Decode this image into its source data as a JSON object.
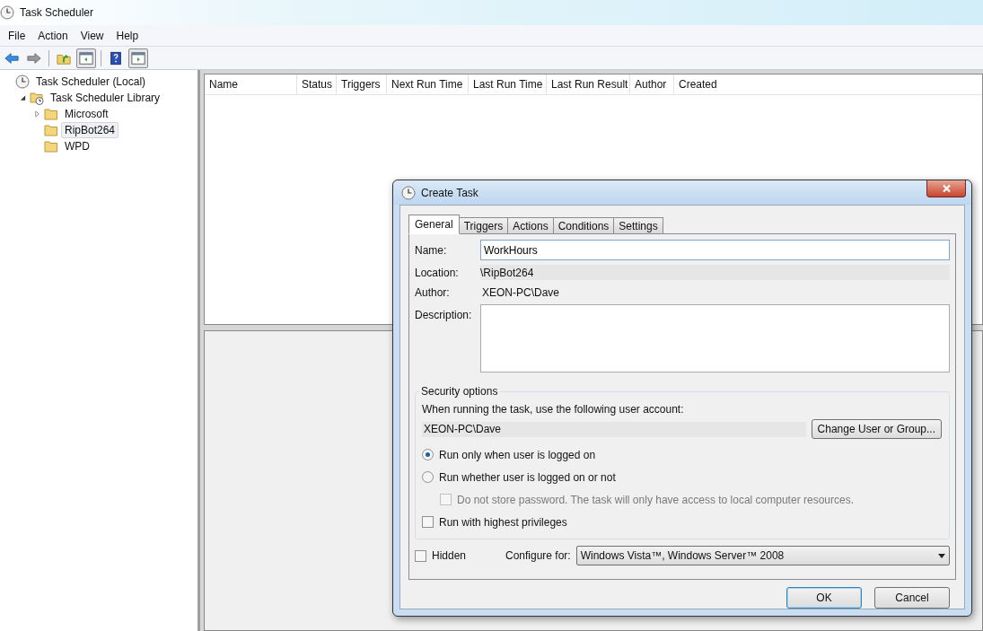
{
  "window": {
    "title": "Task Scheduler"
  },
  "menu": [
    "File",
    "Action",
    "View",
    "Help"
  ],
  "toolbar": [
    {
      "pressed": false
    },
    {
      "pressed": false
    },
    {
      "pressed": false
    },
    {
      "pressed": true
    },
    {
      "pressed": false
    },
    {
      "pressed": true
    }
  ],
  "tree": [
    {
      "label": "Task Scheduler (Local)",
      "kind": "clock",
      "selected": false,
      "children": [
        {
          "label": "Task Scheduler Library",
          "kind": "library",
          "expanded": true,
          "selected": false,
          "children": [
            {
              "label": "Microsoft",
              "kind": "folder",
              "expanded": false,
              "selected": false
            },
            {
              "label": "RipBot264",
              "kind": "folder",
              "selected": true
            },
            {
              "label": "WPD",
              "kind": "folder",
              "selected": false
            }
          ]
        }
      ]
    }
  ],
  "table": {
    "columns": [
      "Name",
      "Status",
      "Triggers",
      "Next Run Time",
      "Last Run Time",
      "Last Run Result",
      "Author",
      "Created"
    ]
  },
  "dialog": {
    "title": "Create Task",
    "tabs": [
      {
        "label": "General",
        "selected": true
      },
      {
        "label": "Triggers",
        "selected": false
      },
      {
        "label": "Actions",
        "selected": false
      },
      {
        "label": "Conditions",
        "selected": false
      },
      {
        "label": "Settings",
        "selected": false
      }
    ],
    "name": {
      "label": "Name:",
      "value": "WorkHours"
    },
    "location": {
      "label": "Location:",
      "value": "\\RipBot264"
    },
    "author": {
      "label": "Author:",
      "value": "XEON-PC\\Dave"
    },
    "description": {
      "label": "Description:"
    },
    "security": {
      "title": "Security options",
      "account_label": "When running the task, use the following user account:",
      "account_value": "XEON-PC\\Dave",
      "change_button": "Change User or Group...",
      "options": [
        {
          "kind": "radio",
          "label": "Run only when user is logged on",
          "selected": true,
          "disabled": false
        },
        {
          "kind": "radio",
          "label": "Run whether user is logged on or not",
          "selected": false,
          "disabled": false,
          "children": [
            {
              "kind": "checkbox",
              "label": "Do not store password.  The task will only have access to local computer resources.",
              "checked": false,
              "disabled": true
            }
          ]
        },
        {
          "kind": "checkbox",
          "label": "Run with highest privileges",
          "checked": false,
          "disabled": false
        }
      ]
    },
    "hidden": {
      "label": "Hidden",
      "checked": false
    },
    "configure": {
      "label": "Configure for:",
      "value": "Windows Vista™, Windows Server™ 2008"
    },
    "buttons": [
      {
        "label": "OK",
        "default": true
      },
      {
        "label": "Cancel",
        "default": false
      }
    ]
  }
}
